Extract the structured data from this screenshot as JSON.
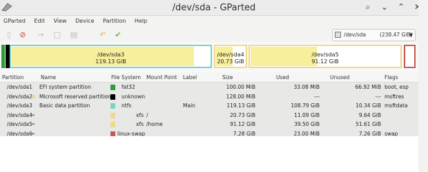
{
  "window": {
    "title": "/dev/sda - GParted",
    "controls": [
      "search-icon",
      "chevron-down-icon",
      "chevron-up-icon",
      "close-icon"
    ]
  },
  "menu": [
    "GParted",
    "Edit",
    "View",
    "Device",
    "Partition",
    "Help"
  ],
  "toolbar": {
    "icons": [
      "new-icon",
      "delete-icon",
      "resize-icon",
      "copy-icon",
      "paste-icon",
      "undo-icon",
      "apply-icon"
    ],
    "device": "/dev/sda",
    "device_size": "(238.47 GiB)"
  },
  "diskmap": [
    {
      "name": "/dev/sda3",
      "size": "119.13 GiB"
    },
    {
      "name": "/dev/sda4",
      "size": "20.73 GiB"
    },
    {
      "name": "/dev/sda5",
      "size": "91.12 GiB"
    }
  ],
  "columns": [
    "Partition",
    "Name",
    "File System",
    "Mount Point",
    "Label",
    "Size",
    "Used",
    "Unused",
    "Flags"
  ],
  "partitions": [
    {
      "partition": "/dev/sda1",
      "name": "EFI system partition",
      "fs": "fat32",
      "fs_color": "#2e9a3c",
      "mount": "",
      "label": "",
      "size": "100.00 MiB",
      "used": "33.08 MiB",
      "unused": "66.92 MiB",
      "flags": "boot, esp"
    },
    {
      "partition": "/dev/sda2",
      "name": "Microsoft reserved partition",
      "fs": "unknown",
      "fs_color": "#000000",
      "mount": "",
      "label": "",
      "size": "128.00 MiB",
      "used": "---",
      "unused": "---",
      "flags": "msftres"
    },
    {
      "partition": "/dev/sda3",
      "name": "Basic data partition",
      "fs": "ntfs",
      "fs_color": "#7bd1c7",
      "mount": "",
      "label": "Main",
      "size": "119.13 GiB",
      "used": "108.79 GiB",
      "unused": "10.34 GiB",
      "flags": "msftdata"
    },
    {
      "partition": "/dev/sda4",
      "name": "",
      "fs": "xfs",
      "fs_color": "#efd98a",
      "mount": "/",
      "label": "",
      "size": "20.73 GiB",
      "used": "11.09 GiB",
      "unused": "9.64 GiB",
      "flags": ""
    },
    {
      "partition": "/dev/sda5",
      "name": "",
      "fs": "xfs",
      "fs_color": "#efd98a",
      "mount": "/home",
      "label": "",
      "size": "91.12 GiB",
      "used": "39.50 GiB",
      "unused": "51.61 GiB",
      "flags": ""
    },
    {
      "partition": "/dev/sda6",
      "name": "",
      "fs": "linux-swap",
      "fs_color": "#c45a52",
      "mount": "",
      "label": "",
      "size": "7.28 GiB",
      "used": "23.00 MiB",
      "unused": "7.26 GiB",
      "flags": "swap"
    }
  ]
}
